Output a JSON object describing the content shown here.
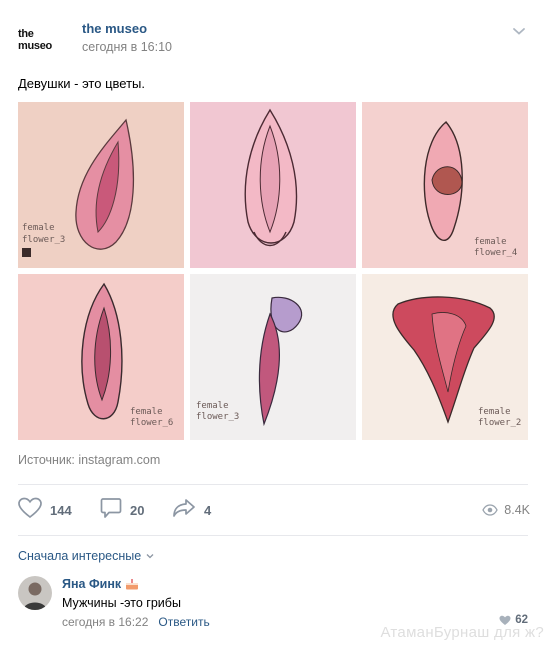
{
  "post": {
    "author": "the museo",
    "logo_text": "the museo",
    "time": "сегодня в 16:10",
    "text": "Девушки - это цветы.",
    "source_label": "Источник:",
    "source_link": "instagram.com"
  },
  "gallery": {
    "images": [
      {
        "caption": "female flower_3",
        "bg": "#efd0c4",
        "fill": "#c9597a",
        "accent": "#e58fa3"
      },
      {
        "caption": "",
        "bg": "#f1c7d2",
        "fill": "#e7a2b5",
        "accent": "#f3b9c6"
      },
      {
        "caption": "female flower_4",
        "bg": "#f4d1cf",
        "fill": "#b05750",
        "accent": "#c87b72"
      },
      {
        "caption": "",
        "bg": "#f4cdc9",
        "fill": "#b8506f",
        "accent": "#e48ea2"
      },
      {
        "caption": "female flower_3",
        "bg": "#f1efef",
        "fill": "#c1587d",
        "accent": "#b69ccd"
      },
      {
        "caption": "female flower_2",
        "bg": "#f6ece4",
        "fill": "#cd4a5e",
        "accent": "#e07384"
      }
    ]
  },
  "actions": {
    "likes": "144",
    "comments": "20",
    "shares": "4",
    "views": "8.4K"
  },
  "comments": {
    "sort_label": "Сначала интересные",
    "items": [
      {
        "author": "Яна Финк",
        "text": "Мужчины -это грибы",
        "time": "сегодня в 16:22",
        "reply_label": "Ответить",
        "likes": "62"
      }
    ]
  },
  "watermark": "АтаманБурнаш для ж?"
}
